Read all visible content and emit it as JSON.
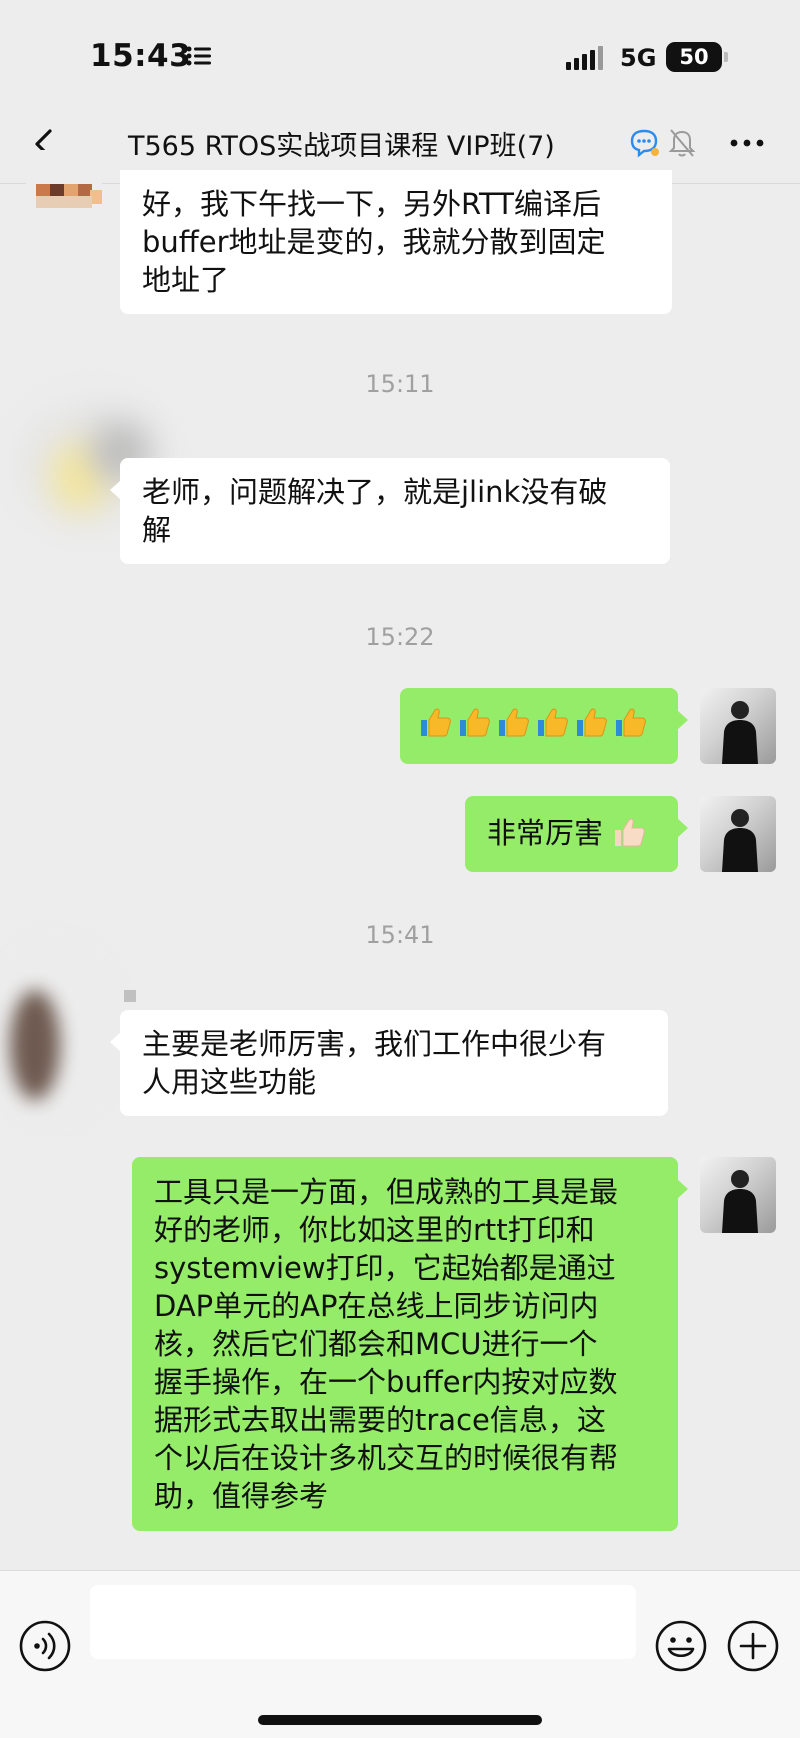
{
  "status_bar": {
    "time": "15:43",
    "network": "5G",
    "battery": "50"
  },
  "header": {
    "back_icon": "chevron-left-icon",
    "title": "T565 RTOS实战项目课程 VIP班(7)"
  },
  "messages": [
    {
      "side": "in",
      "text_lines": [
        "好，我下午找一下，另外RTT编译后",
        "buffer地址是变的，我就分散到固定",
        "地址了"
      ]
    },
    {
      "timestamp": "15:11"
    },
    {
      "side": "in",
      "text_lines": [
        "老师，问题解决了，就是jlink没有破",
        "解"
      ]
    },
    {
      "timestamp": "15:22"
    },
    {
      "side": "out",
      "emoji": "👍👍👍👍👍👍",
      "emoji_count": 6
    },
    {
      "side": "out",
      "text": "非常厉害",
      "emoji": "👍🏻"
    },
    {
      "timestamp": "15:41"
    },
    {
      "side": "in",
      "text_lines": [
        "主要是老师厉害，我们工作中很少有",
        "人用这些功能"
      ]
    },
    {
      "side": "out",
      "text_lines": [
        "工具只是一方面，但成熟的工具是最",
        "好的老师，你比如这里的rtt打印和",
        "systemview打印，它起始都是通过",
        "DAP单元的AP在总线上同步访问内",
        "核，然后它们都会和MCU进行一个",
        "握手操作，在一个buffer内按对应数",
        "据形式去取出需要的trace信息，这",
        "个以后在设计多机交互的时候很有帮",
        "助，值得参考"
      ]
    }
  ],
  "composer": {
    "input_value": "",
    "voice_icon": "voice-icon",
    "emoji_icon": "emoji-icon",
    "plus_icon": "plus-icon"
  },
  "colors": {
    "background": "#ededed",
    "outgoing_bubble": "#95ec69",
    "incoming_bubble": "#ffffff",
    "timestamp": "#a0a0a0"
  }
}
